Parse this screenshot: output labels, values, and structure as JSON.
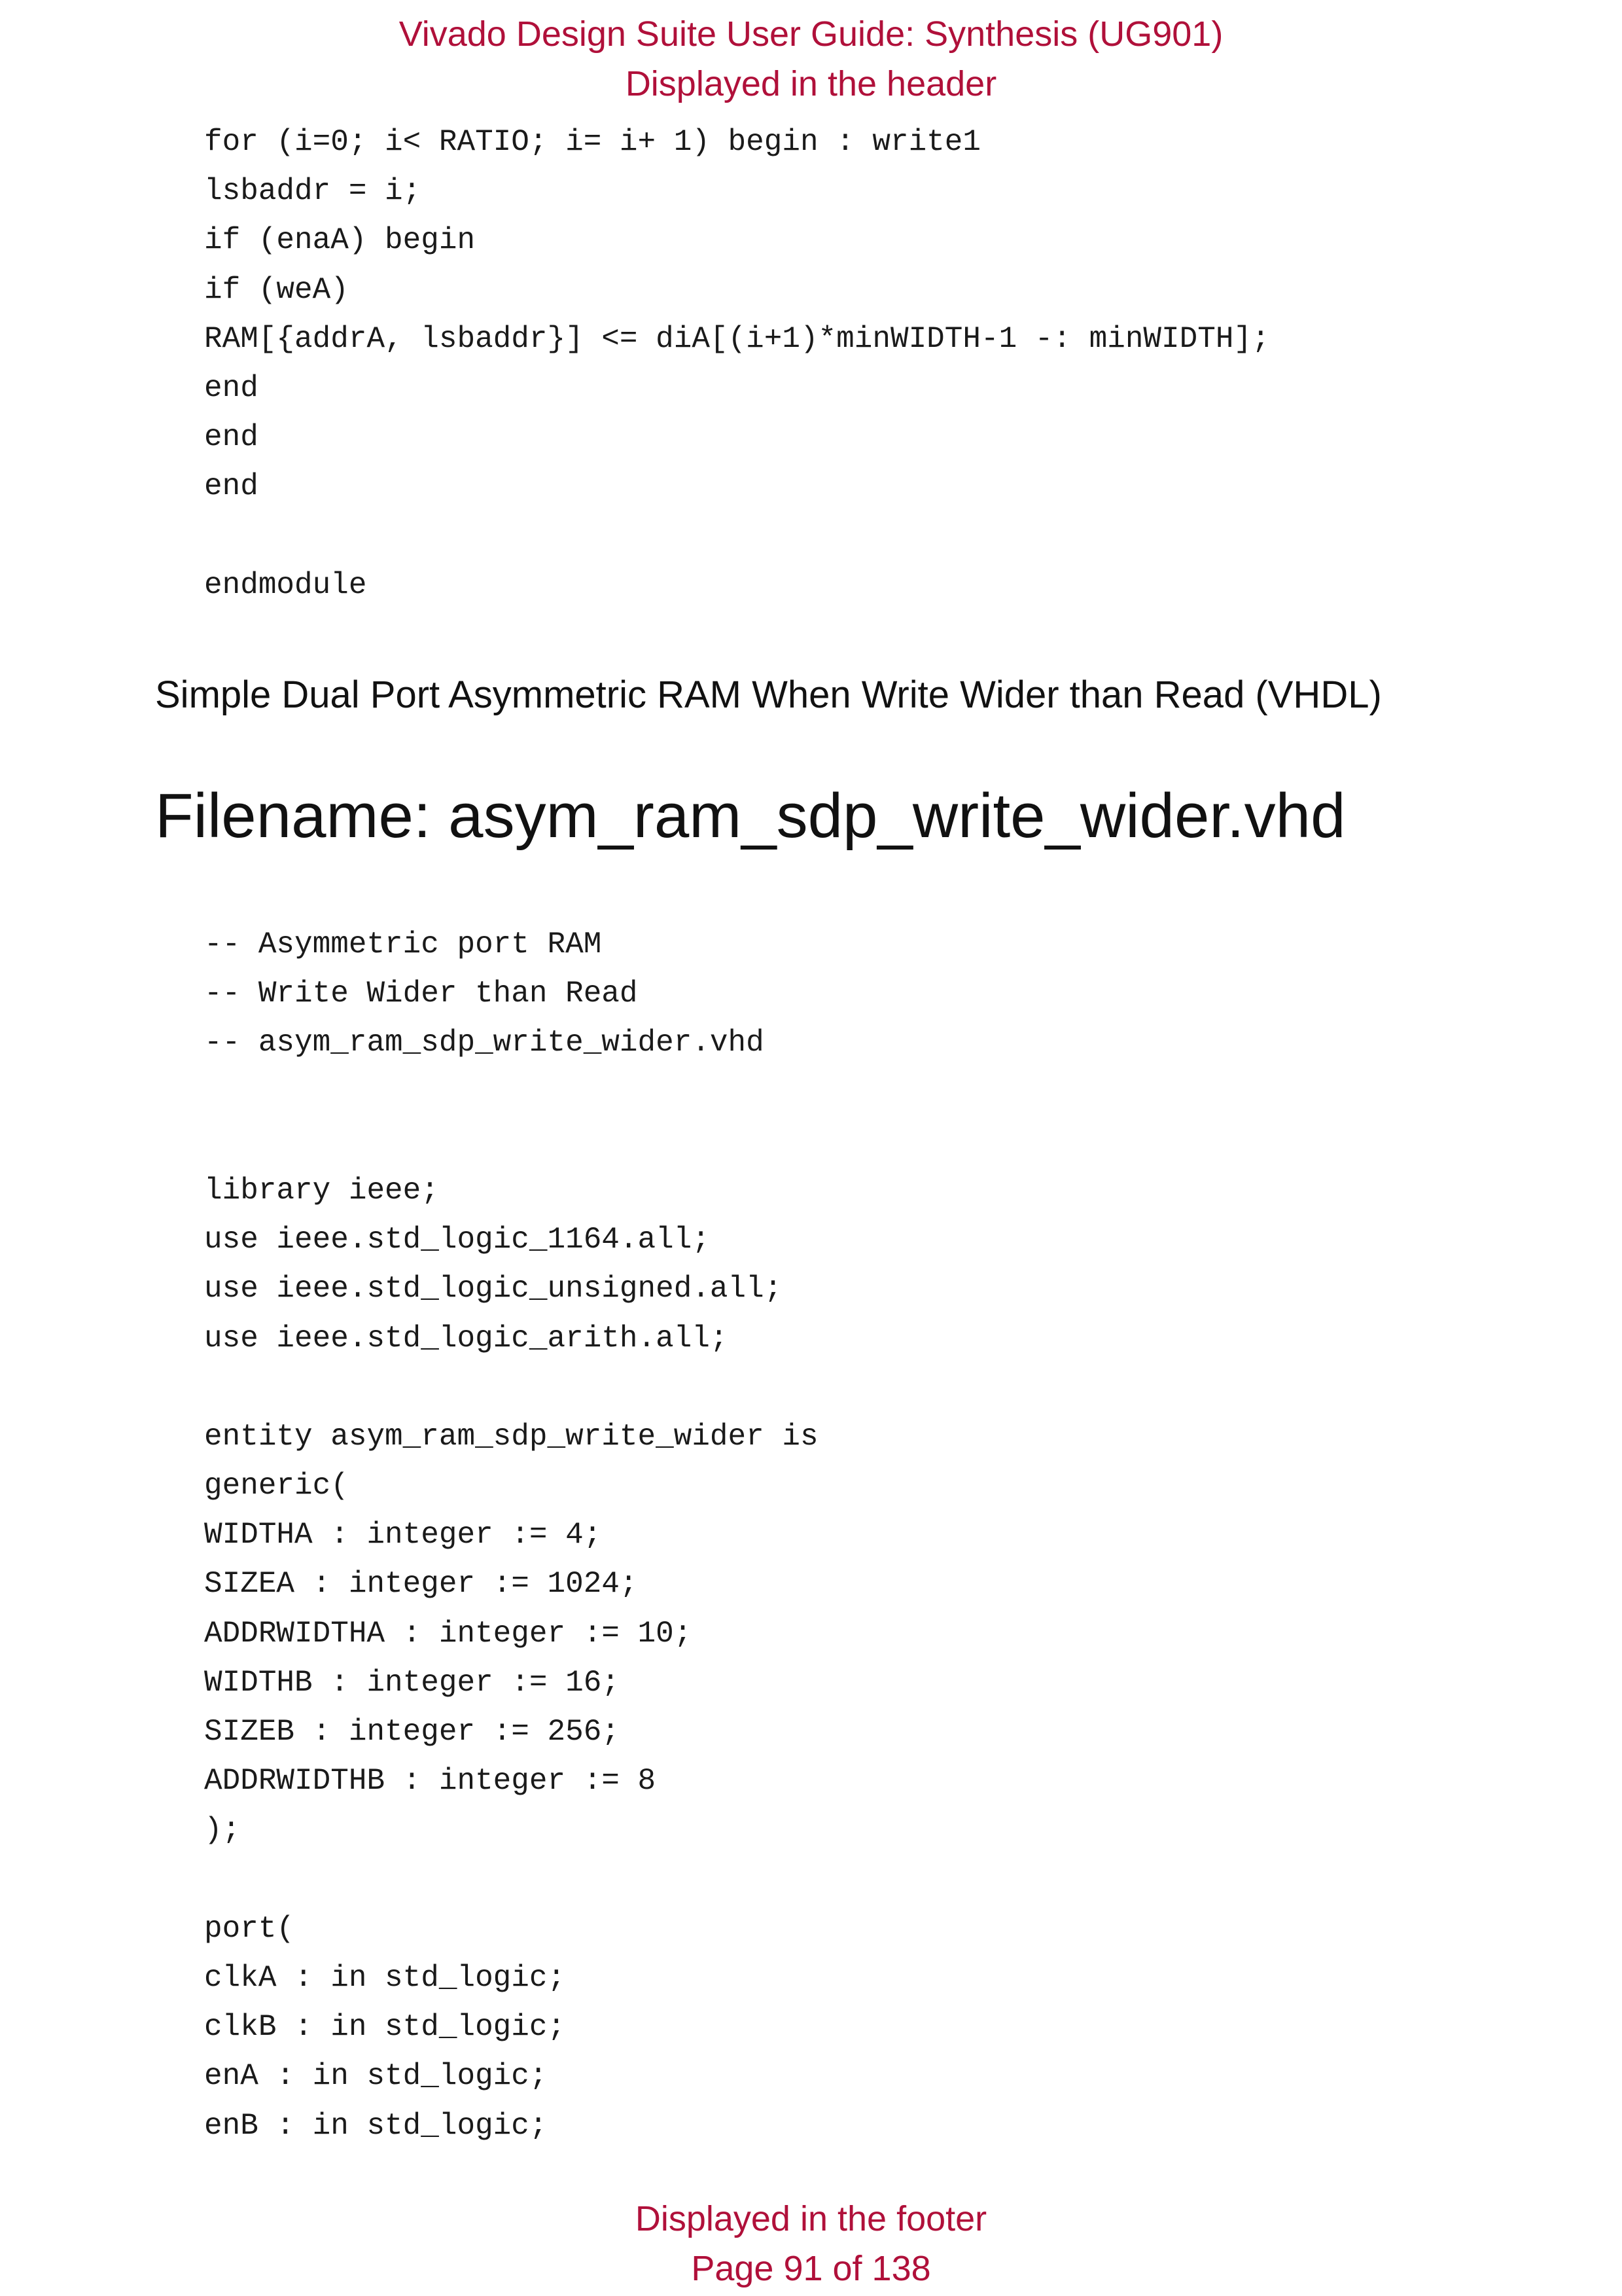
{
  "header": {
    "title": "Vivado Design Suite User Guide: Synthesis (UG901)",
    "subtitle": "Displayed in the header"
  },
  "code_top": [
    "for (i=0; i< RATIO; i= i+ 1) begin : write1",
    "lsbaddr = i;",
    "if (enaA) begin",
    "if (weA)",
    "RAM[{addrA, lsbaddr}] <= diA[(i+1)*minWIDTH-1 -: minWIDTH];",
    "end",
    "end",
    "end",
    "",
    "endmodule"
  ],
  "section_heading": "Simple Dual Port Asymmetric RAM When Write Wider than Read (VHDL)",
  "filename_heading": "Filename: asym_ram_sdp_write_wider.vhd",
  "code_main": [
    "-- Asymmetric port RAM",
    "-- Write Wider than Read",
    "-- asym_ram_sdp_write_wider.vhd",
    "",
    "",
    "library ieee;",
    "use ieee.std_logic_1164.all;",
    "use ieee.std_logic_unsigned.all;",
    "use ieee.std_logic_arith.all;",
    "",
    "entity asym_ram_sdp_write_wider is",
    "generic(",
    "WIDTHA : integer := 4;",
    "SIZEA : integer := 1024;",
    "ADDRWIDTHA : integer := 10;",
    "WIDTHB : integer := 16;",
    "SIZEB : integer := 256;",
    "ADDRWIDTHB : integer := 8",
    ");",
    "",
    "port(",
    "clkA : in std_logic;",
    "clkB : in std_logic;",
    "enA : in std_logic;",
    "enB : in std_logic;"
  ],
  "footer": {
    "note": "Displayed in the footer",
    "page": "Page 91 of 138"
  }
}
